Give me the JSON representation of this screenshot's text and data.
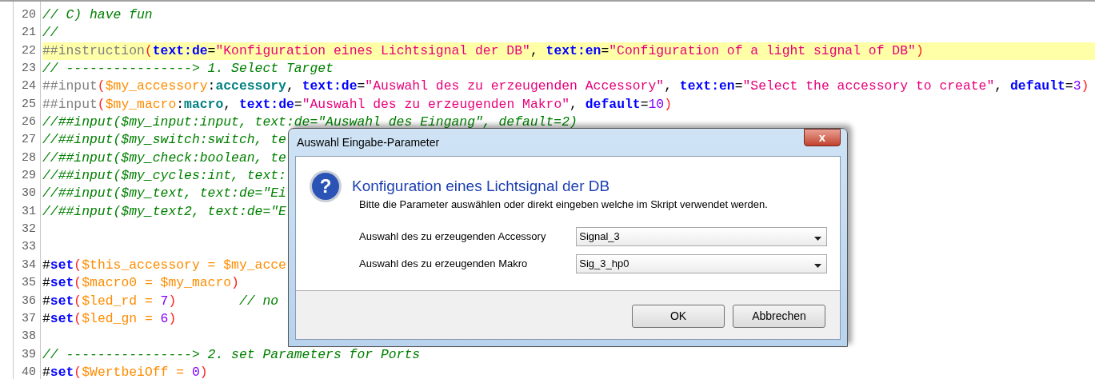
{
  "editor": {
    "lines": [
      {
        "number": "20",
        "highlighted": false,
        "tokens": [
          {
            "kind": "comment",
            "text": "// C) have fun"
          }
        ]
      },
      {
        "number": "21",
        "highlighted": false,
        "tokens": [
          {
            "kind": "comment",
            "text": "//"
          }
        ]
      },
      {
        "number": "22",
        "highlighted": true,
        "tokens": [
          {
            "kind": "directive",
            "text": "##instruction"
          },
          {
            "kind": "paren",
            "text": "("
          },
          {
            "kind": "attr",
            "text": "text:de"
          },
          {
            "kind": "plain",
            "text": "="
          },
          {
            "kind": "string",
            "text": "\"Konfiguration eines Lichtsignal der DB\""
          },
          {
            "kind": "plain",
            "text": ", "
          },
          {
            "kind": "attr",
            "text": "text:en"
          },
          {
            "kind": "plain",
            "text": "="
          },
          {
            "kind": "string",
            "text": "\"Configuration of a light signal of DB\""
          },
          {
            "kind": "paren",
            "text": ")"
          }
        ]
      },
      {
        "number": "23",
        "highlighted": false,
        "tokens": [
          {
            "kind": "comment",
            "text": "// ----------------> 1. Select Target"
          }
        ]
      },
      {
        "number": "24",
        "highlighted": false,
        "tokens": [
          {
            "kind": "directive",
            "text": "##input"
          },
          {
            "kind": "paren",
            "text": "("
          },
          {
            "kind": "variable",
            "text": "$my_accessory"
          },
          {
            "kind": "plain",
            "text": ":"
          },
          {
            "kind": "type",
            "text": "accessory"
          },
          {
            "kind": "plain",
            "text": ", "
          },
          {
            "kind": "attr",
            "text": "text:de"
          },
          {
            "kind": "plain",
            "text": "="
          },
          {
            "kind": "string",
            "text": "\"Auswahl des zu erzeugenden Accessory\""
          },
          {
            "kind": "plain",
            "text": ", "
          },
          {
            "kind": "attr",
            "text": "text:en"
          },
          {
            "kind": "plain",
            "text": "="
          },
          {
            "kind": "string",
            "text": "\"Select the accessory to create\""
          },
          {
            "kind": "plain",
            "text": ", "
          },
          {
            "kind": "attr",
            "text": "default"
          },
          {
            "kind": "plain",
            "text": "="
          },
          {
            "kind": "number",
            "text": "3"
          },
          {
            "kind": "paren",
            "text": ")"
          }
        ]
      },
      {
        "number": "25",
        "highlighted": false,
        "tokens": [
          {
            "kind": "directive",
            "text": "##input"
          },
          {
            "kind": "paren",
            "text": "("
          },
          {
            "kind": "variable",
            "text": "$my_macro"
          },
          {
            "kind": "plain",
            "text": ":"
          },
          {
            "kind": "type",
            "text": "macro"
          },
          {
            "kind": "plain",
            "text": ", "
          },
          {
            "kind": "attr",
            "text": "text:de"
          },
          {
            "kind": "plain",
            "text": "="
          },
          {
            "kind": "string",
            "text": "\"Auswahl des zu erzeugenden Makro\""
          },
          {
            "kind": "plain",
            "text": ", "
          },
          {
            "kind": "attr",
            "text": "default"
          },
          {
            "kind": "plain",
            "text": "="
          },
          {
            "kind": "number",
            "text": "10"
          },
          {
            "kind": "paren",
            "text": ")"
          }
        ]
      },
      {
        "number": "26",
        "highlighted": false,
        "tokens": [
          {
            "kind": "comment",
            "text": "//##input($my_input:input, text:de=\"Auswahl des Eingang\", default=2)"
          }
        ]
      },
      {
        "number": "27",
        "highlighted": false,
        "tokens": [
          {
            "kind": "comment",
            "text": "//##input($my_switch:switch, te"
          }
        ]
      },
      {
        "number": "28",
        "highlighted": false,
        "tokens": [
          {
            "kind": "comment",
            "text": "//##input($my_check:boolean, te"
          }
        ]
      },
      {
        "number": "29",
        "highlighted": false,
        "tokens": [
          {
            "kind": "comment",
            "text": "//##input($my_cycles:int, text:"
          }
        ]
      },
      {
        "number": "30",
        "highlighted": false,
        "tokens": [
          {
            "kind": "comment",
            "text": "//##input($my_text, text:de=\"Ei"
          }
        ]
      },
      {
        "number": "31",
        "highlighted": false,
        "tokens": [
          {
            "kind": "comment",
            "text": "//##input($my_text2, text:de=\"E"
          }
        ]
      },
      {
        "number": "32",
        "highlighted": false
      },
      {
        "number": "33",
        "highlighted": false
      },
      {
        "number": "34",
        "highlighted": false,
        "tokens": [
          {
            "kind": "plain",
            "text": "#"
          },
          {
            "kind": "keyword",
            "text": "set"
          },
          {
            "kind": "paren",
            "text": "("
          },
          {
            "kind": "variable",
            "text": "$this_accessory = $my_acce"
          }
        ]
      },
      {
        "number": "35",
        "highlighted": false,
        "tokens": [
          {
            "kind": "plain",
            "text": "#"
          },
          {
            "kind": "keyword",
            "text": "set"
          },
          {
            "kind": "paren",
            "text": "("
          },
          {
            "kind": "variable",
            "text": "$macro0 = $my_macro"
          },
          {
            "kind": "paren",
            "text": ")"
          }
        ]
      },
      {
        "number": "36",
        "highlighted": false,
        "tokens": [
          {
            "kind": "plain",
            "text": "#"
          },
          {
            "kind": "keyword",
            "text": "set"
          },
          {
            "kind": "paren",
            "text": "("
          },
          {
            "kind": "variable",
            "text": "$led_rd = "
          },
          {
            "kind": "number",
            "text": "7"
          },
          {
            "kind": "paren",
            "text": ")"
          },
          {
            "kind": "comment",
            "text": "        // no"
          }
        ]
      },
      {
        "number": "37",
        "highlighted": false,
        "tokens": [
          {
            "kind": "plain",
            "text": "#"
          },
          {
            "kind": "keyword",
            "text": "set"
          },
          {
            "kind": "paren",
            "text": "("
          },
          {
            "kind": "variable",
            "text": "$led_gn = "
          },
          {
            "kind": "number",
            "text": "6"
          },
          {
            "kind": "paren",
            "text": ")"
          }
        ]
      },
      {
        "number": "38",
        "highlighted": false
      },
      {
        "number": "39",
        "highlighted": false,
        "tokens": [
          {
            "kind": "comment",
            "text": "// ----------------> 2. set Parameters for Ports"
          }
        ]
      },
      {
        "number": "40",
        "highlighted": false,
        "tokens": [
          {
            "kind": "plain",
            "text": "#"
          },
          {
            "kind": "keyword",
            "text": "set"
          },
          {
            "kind": "paren",
            "text": "("
          },
          {
            "kind": "variable",
            "text": "$WertbeiOff = "
          },
          {
            "kind": "number",
            "text": "0"
          },
          {
            "kind": "paren",
            "text": ")"
          }
        ]
      }
    ]
  },
  "dialog": {
    "title": "Auswahl Eingabe-Parameter",
    "close": "x",
    "icon": "?",
    "heading": "Konfiguration eines Lichtsignal der DB",
    "description": "Bitte die Parameter auswählen oder direkt eingeben welche im Skript verwendet werden.",
    "fields": [
      {
        "label": "Auswahl des zu erzeugenden Accessory",
        "value": "Signal_3"
      },
      {
        "label": "Auswahl des zu erzeugenden Makro",
        "value": "Sig_3_hp0"
      }
    ],
    "buttons": [
      "OK",
      "Abbrechen"
    ]
  }
}
